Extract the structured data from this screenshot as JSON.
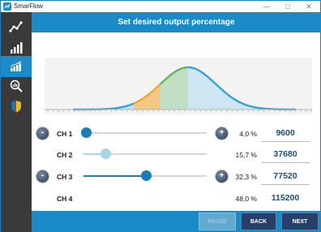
{
  "window": {
    "title": "SmarFlow",
    "minimize": "—",
    "maximize": "□",
    "close": "✕"
  },
  "header": {
    "title": "Set desired output percentage"
  },
  "sidebar": {
    "items": [
      {
        "icon": "graph-line-icon",
        "active": false
      },
      {
        "icon": "bar-chart-icon",
        "active": false
      },
      {
        "icon": "signal-bars-icon",
        "active": true
      },
      {
        "icon": "search-chart-icon",
        "active": false
      },
      {
        "icon": "shield-icon",
        "active": false
      }
    ]
  },
  "chart_data": {
    "type": "area",
    "description_series": "bell curve distribution split into four channel segments",
    "segment_colors": [
      "#bfe0f2",
      "#f3c37a",
      "#bcdcc0",
      "#c9e4f2"
    ],
    "curve_colors": [
      "#3aa0cf",
      "#f0a830",
      "#5db85c",
      "#3aa0cf"
    ],
    "segments_percent": [
      4.0,
      15.7,
      32.3,
      48.0
    ]
  },
  "channels": [
    {
      "label": "CH 1",
      "percent": "4,0 %",
      "value": "9600",
      "slider": 0.04,
      "has_buttons": true,
      "thumb_style": "dark"
    },
    {
      "label": "CH 2",
      "percent": "15,7 %",
      "value": "37680",
      "slider": 0.157,
      "has_buttons": false,
      "thumb_style": "light"
    },
    {
      "label": "CH 3",
      "percent": "32,3 %",
      "value": "77520",
      "slider": 0.52,
      "has_buttons": true,
      "thumb_style": "dark"
    },
    {
      "label": "CH 4",
      "percent": "48,0 %",
      "value": "115200",
      "slider": null,
      "has_buttons": false,
      "thumb_style": "none"
    }
  ],
  "buttons": {
    "minus": "-",
    "plus": "+"
  },
  "footer": {
    "pause": "PAUSE",
    "back": "BACK",
    "next": "NEXT"
  }
}
